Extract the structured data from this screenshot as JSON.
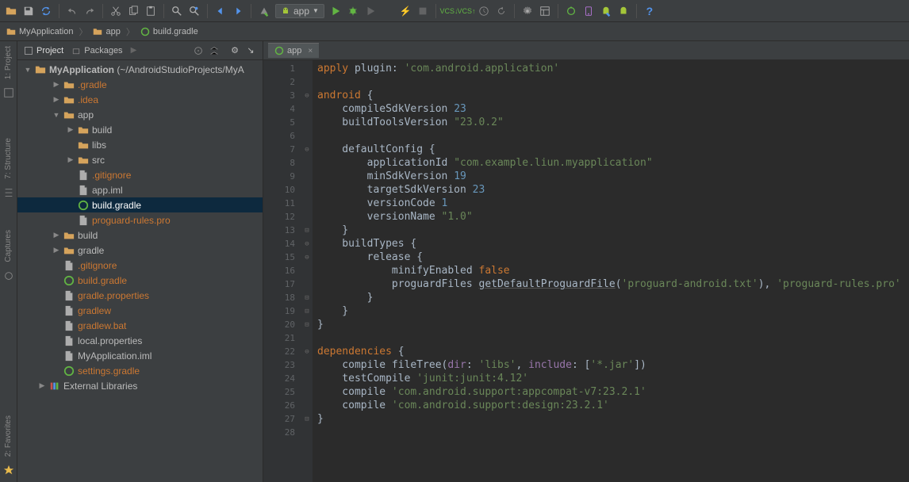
{
  "toolbar": {
    "run_selector": "app"
  },
  "breadcrumb": {
    "items": [
      "MyApplication",
      "app",
      "build.gradle"
    ]
  },
  "panel": {
    "tab_project": "Project",
    "tab_packages": "Packages"
  },
  "rails": {
    "project": "1: Project",
    "structure": "7: Structure",
    "captures": "Captures",
    "favorites": "2: Favorites"
  },
  "tree": {
    "root": "MyApplication",
    "root_hint": "(~/AndroidStudioProjects/MyA",
    "nodes": [
      {
        "depth": 1,
        "arrow": "▶",
        "icon": "folder",
        "label": ".gradle",
        "cls": "orange"
      },
      {
        "depth": 1,
        "arrow": "▶",
        "icon": "folder",
        "label": ".idea",
        "cls": "orange"
      },
      {
        "depth": 1,
        "arrow": "▼",
        "icon": "folder",
        "label": "app"
      },
      {
        "depth": 2,
        "arrow": "▶",
        "icon": "folder",
        "label": "build"
      },
      {
        "depth": 2,
        "arrow": "",
        "icon": "folder",
        "label": "libs"
      },
      {
        "depth": 2,
        "arrow": "▶",
        "icon": "folder",
        "label": "src"
      },
      {
        "depth": 2,
        "arrow": "",
        "icon": "file",
        "label": ".gitignore",
        "cls": "orange"
      },
      {
        "depth": 2,
        "arrow": "",
        "icon": "file",
        "label": "app.iml"
      },
      {
        "depth": 2,
        "arrow": "",
        "icon": "gradle",
        "label": "build.gradle",
        "selected": true
      },
      {
        "depth": 2,
        "arrow": "",
        "icon": "file",
        "label": "proguard-rules.pro",
        "cls": "orange"
      },
      {
        "depth": 1,
        "arrow": "▶",
        "icon": "folder",
        "label": "build"
      },
      {
        "depth": 1,
        "arrow": "▶",
        "icon": "folder",
        "label": "gradle"
      },
      {
        "depth": 1,
        "arrow": "",
        "icon": "file",
        "label": ".gitignore",
        "cls": "orange"
      },
      {
        "depth": 1,
        "arrow": "",
        "icon": "gradle",
        "label": "build.gradle",
        "cls": "orange"
      },
      {
        "depth": 1,
        "arrow": "",
        "icon": "file",
        "label": "gradle.properties",
        "cls": "orange"
      },
      {
        "depth": 1,
        "arrow": "",
        "icon": "file",
        "label": "gradlew",
        "cls": "orange"
      },
      {
        "depth": 1,
        "arrow": "",
        "icon": "file",
        "label": "gradlew.bat",
        "cls": "orange"
      },
      {
        "depth": 1,
        "arrow": "",
        "icon": "file",
        "label": "local.properties"
      },
      {
        "depth": 1,
        "arrow": "",
        "icon": "file",
        "label": "MyApplication.iml"
      },
      {
        "depth": 1,
        "arrow": "",
        "icon": "gradle",
        "label": "settings.gradle",
        "cls": "orange"
      },
      {
        "depth": 0,
        "arrow": "▶",
        "icon": "lib",
        "label": "External Libraries"
      }
    ]
  },
  "editor": {
    "tab_label": "app",
    "code": [
      {
        "n": 1,
        "t": [
          [
            "kw",
            "apply"
          ],
          [
            "",
            " plugin: "
          ],
          [
            "str",
            "'com.android.application'"
          ]
        ]
      },
      {
        "n": 2,
        "t": [
          [
            "",
            ""
          ]
        ]
      },
      {
        "n": 3,
        "t": [
          [
            "kw",
            "android"
          ],
          [
            "",
            " {"
          ]
        ]
      },
      {
        "n": 4,
        "t": [
          [
            "",
            "    compileSdkVersion "
          ],
          [
            "num",
            "23"
          ]
        ]
      },
      {
        "n": 5,
        "t": [
          [
            "",
            "    buildToolsVersion "
          ],
          [
            "str",
            "\"23.0.2\""
          ]
        ]
      },
      {
        "n": 6,
        "t": [
          [
            "",
            ""
          ]
        ]
      },
      {
        "n": 7,
        "t": [
          [
            "",
            "    defaultConfig {"
          ]
        ]
      },
      {
        "n": 8,
        "t": [
          [
            "",
            "        applicationId "
          ],
          [
            "str",
            "\"com.example.liun.myapplication\""
          ]
        ]
      },
      {
        "n": 9,
        "t": [
          [
            "",
            "        minSdkVersion "
          ],
          [
            "num",
            "19"
          ]
        ]
      },
      {
        "n": 10,
        "t": [
          [
            "",
            "        targetSdkVersion "
          ],
          [
            "num",
            "23"
          ]
        ]
      },
      {
        "n": 11,
        "t": [
          [
            "",
            "        versionCode "
          ],
          [
            "num",
            "1"
          ]
        ]
      },
      {
        "n": 12,
        "t": [
          [
            "",
            "        versionName "
          ],
          [
            "str",
            "\"1.0\""
          ]
        ]
      },
      {
        "n": 13,
        "t": [
          [
            "",
            "    }"
          ]
        ]
      },
      {
        "n": 14,
        "t": [
          [
            "",
            "    buildTypes {"
          ]
        ]
      },
      {
        "n": 15,
        "t": [
          [
            "",
            "        release {"
          ]
        ]
      },
      {
        "n": 16,
        "t": [
          [
            "",
            "            minifyEnabled "
          ],
          [
            "kw",
            "false"
          ]
        ]
      },
      {
        "n": 17,
        "t": [
          [
            "",
            "            proguardFiles "
          ],
          [
            "fn",
            "getDefaultProguardFile"
          ],
          [
            "",
            "("
          ],
          [
            "str",
            "'proguard-android.txt'"
          ],
          [
            "",
            "), "
          ],
          [
            "str",
            "'proguard-rules.pro'"
          ]
        ]
      },
      {
        "n": 18,
        "t": [
          [
            "",
            "        }"
          ]
        ]
      },
      {
        "n": 19,
        "t": [
          [
            "",
            "    }"
          ]
        ]
      },
      {
        "n": 20,
        "t": [
          [
            "",
            "}"
          ]
        ]
      },
      {
        "n": 21,
        "t": [
          [
            "",
            ""
          ]
        ]
      },
      {
        "n": 22,
        "t": [
          [
            "kw",
            "dependencies"
          ],
          [
            "",
            " {"
          ]
        ]
      },
      {
        "n": 23,
        "t": [
          [
            "",
            "    compile fileTree("
          ],
          [
            "prop",
            "dir"
          ],
          [
            "",
            ": "
          ],
          [
            "str",
            "'libs'"
          ],
          [
            "",
            ", "
          ],
          [
            "prop",
            "include"
          ],
          [
            "",
            ": ["
          ],
          [
            "str",
            "'*.jar'"
          ],
          [
            "",
            "])"
          ]
        ]
      },
      {
        "n": 24,
        "t": [
          [
            "",
            "    testCompile "
          ],
          [
            "str",
            "'junit:junit:4.12'"
          ]
        ]
      },
      {
        "n": 25,
        "t": [
          [
            "",
            "    compile "
          ],
          [
            "str",
            "'com.android.support:appcompat-v7:23.2.1'"
          ]
        ]
      },
      {
        "n": 26,
        "t": [
          [
            "",
            "    compile "
          ],
          [
            "str",
            "'com.android.support:design:23.2.1'"
          ]
        ]
      },
      {
        "n": 27,
        "t": [
          [
            "",
            "}"
          ]
        ]
      },
      {
        "n": 28,
        "t": [
          [
            "",
            ""
          ]
        ]
      }
    ]
  }
}
